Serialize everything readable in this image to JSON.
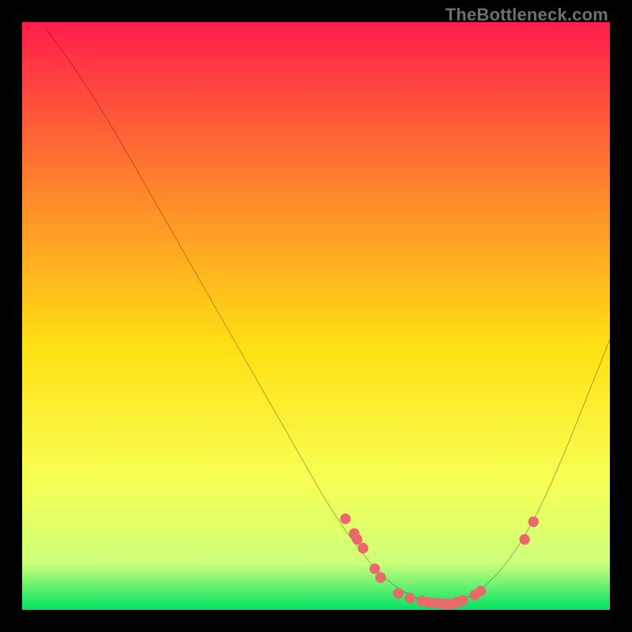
{
  "watermark": "TheBottleneck.com",
  "chart_data": {
    "type": "line",
    "title": "",
    "xlabel": "",
    "ylabel": "",
    "xlim": [
      0,
      100
    ],
    "ylim": [
      0,
      100
    ],
    "background_gradient": {
      "top": "#ff1d4b",
      "mid_upper": "#ff8a2a",
      "mid": "#ffe013",
      "mid_lower": "#f7ff54",
      "green_band": "#ceff7a",
      "bottom": "#00e264"
    },
    "curve": [
      {
        "x": 4.0,
        "y": 99.0
      },
      {
        "x": 8.0,
        "y": 93.5
      },
      {
        "x": 12.0,
        "y": 87.5
      },
      {
        "x": 16.0,
        "y": 81.0
      },
      {
        "x": 20.0,
        "y": 74.0
      },
      {
        "x": 24.0,
        "y": 67.0
      },
      {
        "x": 28.0,
        "y": 60.0
      },
      {
        "x": 32.0,
        "y": 53.0
      },
      {
        "x": 36.0,
        "y": 46.0
      },
      {
        "x": 40.0,
        "y": 39.0
      },
      {
        "x": 44.0,
        "y": 32.0
      },
      {
        "x": 48.0,
        "y": 25.0
      },
      {
        "x": 52.0,
        "y": 18.0
      },
      {
        "x": 56.0,
        "y": 12.0
      },
      {
        "x": 60.0,
        "y": 7.0
      },
      {
        "x": 64.0,
        "y": 3.5
      },
      {
        "x": 68.0,
        "y": 1.5
      },
      {
        "x": 72.0,
        "y": 1.0
      },
      {
        "x": 76.0,
        "y": 2.0
      },
      {
        "x": 80.0,
        "y": 5.0
      },
      {
        "x": 84.0,
        "y": 10.0
      },
      {
        "x": 88.0,
        "y": 17.0
      },
      {
        "x": 92.0,
        "y": 26.0
      },
      {
        "x": 96.0,
        "y": 36.0
      },
      {
        "x": 100.0,
        "y": 46.0
      }
    ],
    "markers": [
      {
        "x": 55.0,
        "y": 15.5
      },
      {
        "x": 56.5,
        "y": 13.0
      },
      {
        "x": 57.0,
        "y": 12.0
      },
      {
        "x": 58.0,
        "y": 10.5
      },
      {
        "x": 60.0,
        "y": 7.0
      },
      {
        "x": 61.0,
        "y": 5.5
      },
      {
        "x": 64.0,
        "y": 2.8
      },
      {
        "x": 66.0,
        "y": 2.0
      },
      {
        "x": 68.0,
        "y": 1.5
      },
      {
        "x": 69.0,
        "y": 1.3
      },
      {
        "x": 70.0,
        "y": 1.2
      },
      {
        "x": 71.0,
        "y": 1.1
      },
      {
        "x": 72.0,
        "y": 1.0
      },
      {
        "x": 73.0,
        "y": 1.0
      },
      {
        "x": 74.0,
        "y": 1.3
      },
      {
        "x": 75.0,
        "y": 1.6
      },
      {
        "x": 77.0,
        "y": 2.5
      },
      {
        "x": 78.0,
        "y": 3.2
      },
      {
        "x": 85.5,
        "y": 12.0
      },
      {
        "x": 87.0,
        "y": 15.0
      }
    ],
    "marker_color": "#e96a6a",
    "curve_color": "#000000"
  }
}
